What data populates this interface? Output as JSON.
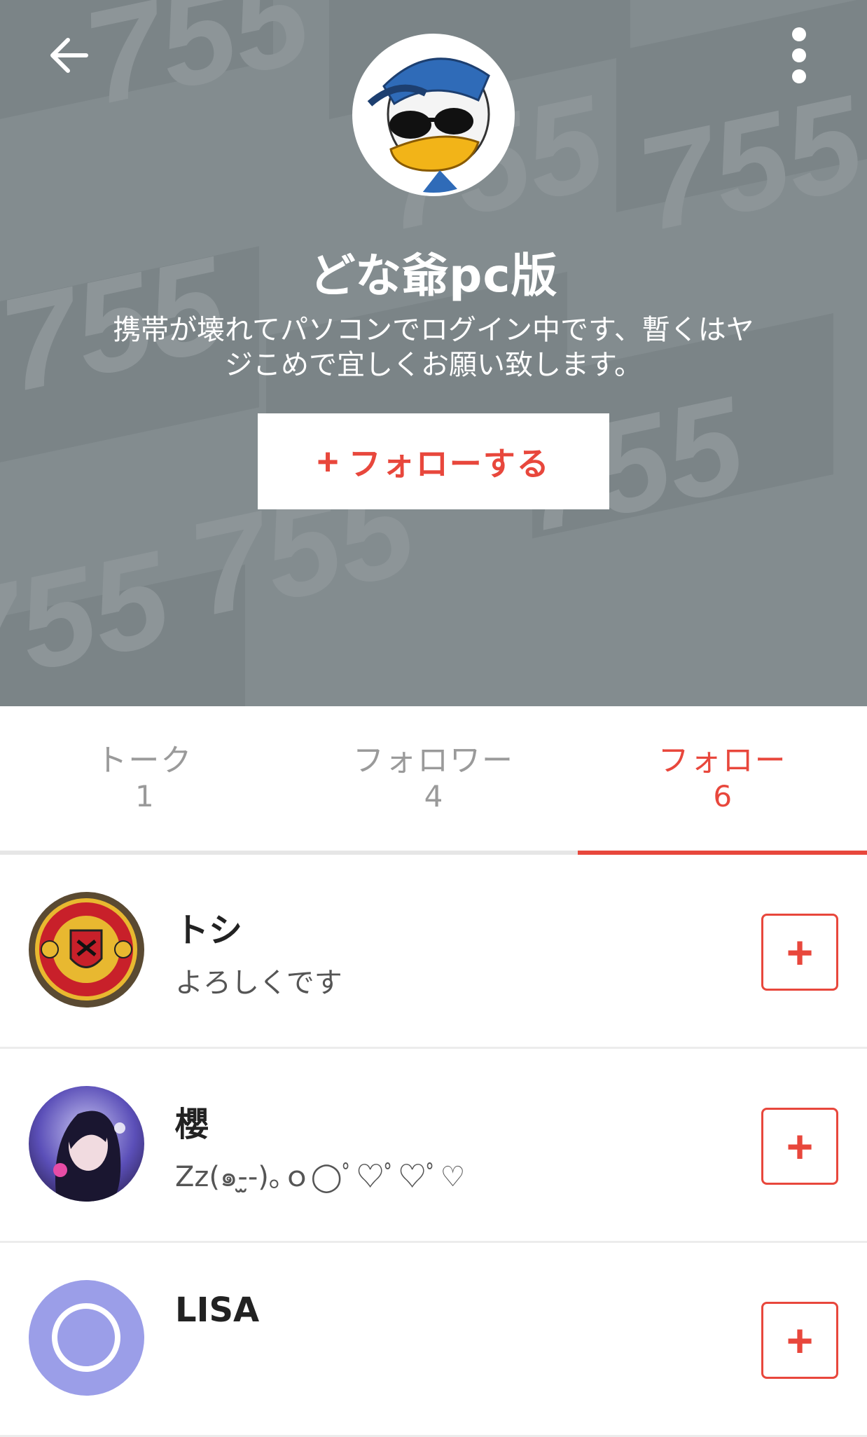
{
  "header": {
    "background_color": "#838c8f",
    "watermark_text": "755",
    "back_icon": "arrow-left-icon",
    "menu_icon": "more-vertical-icon",
    "avatar_icon": "duck-sunglasses-avatar-icon",
    "name": "どな爺pc版",
    "bio": "携帯が壊れてパソコンでログイン中です、暫くはヤジこめで宜しくお願い致します。",
    "follow_button": {
      "icon": "plus-icon",
      "plus": "+",
      "label": "フォローする"
    }
  },
  "tabs": [
    {
      "label": "トーク",
      "count": "1",
      "active": false
    },
    {
      "label": "フォロワー",
      "count": "4",
      "active": false
    },
    {
      "label": "フォロー",
      "count": "6",
      "active": true
    }
  ],
  "list": [
    {
      "name": "トシ",
      "message": "よろしくです",
      "avatar_icon": "manchester-united-crest-icon",
      "button": "+"
    },
    {
      "name": "櫻",
      "message": "Zz(๑-̫̫-)｡ｏ◯ﾟ♡ﾟ♡ﾟ♡",
      "avatar_icon": "anime-girl-avatar-icon",
      "button": "+"
    },
    {
      "name": "LISA",
      "message": "",
      "avatar_icon": "default-user-avatar-icon",
      "button": "+"
    }
  ],
  "colors": {
    "accent": "#e8473c",
    "header_bg": "#838c8f",
    "tab_inactive": "#9a9a9a"
  }
}
